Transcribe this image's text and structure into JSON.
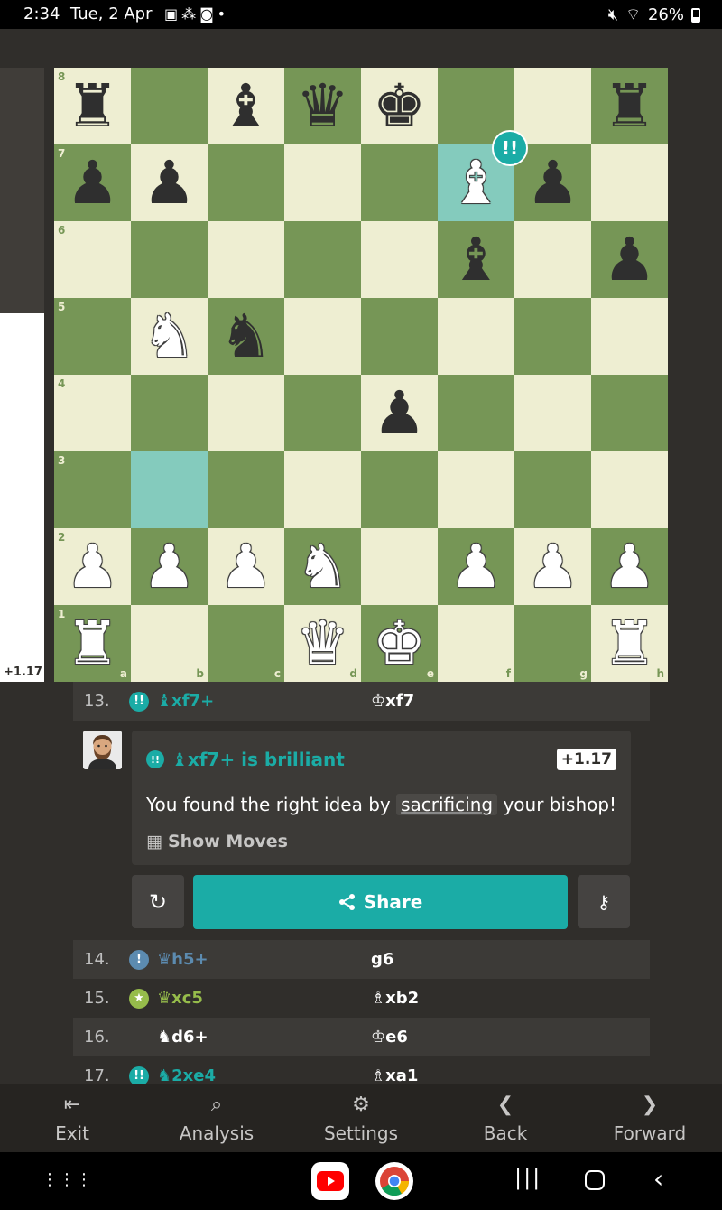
{
  "status": {
    "time": "2:34",
    "date": "Tue, 2 Apr",
    "battery": "26%"
  },
  "eval": {
    "value": "+1.17",
    "white_fraction": 0.6
  },
  "board": {
    "rank_labels": [
      "8",
      "7",
      "6",
      "5",
      "4",
      "3",
      "2",
      "1"
    ],
    "file_labels": [
      "a",
      "b",
      "c",
      "d",
      "e",
      "f",
      "g",
      "h"
    ],
    "rows": [
      [
        "br",
        "",
        "bb",
        "bq",
        "bk",
        "",
        "",
        "br"
      ],
      [
        "bp",
        "bp",
        "",
        "",
        "",
        "wb",
        "bp",
        ""
      ],
      [
        "",
        "",
        "",
        "",
        "",
        "bb",
        "",
        "bp"
      ],
      [
        "",
        "wn",
        "bn",
        "",
        "",
        "",
        "",
        ""
      ],
      [
        "",
        "",
        "",
        "",
        "bp",
        "",
        "",
        ""
      ],
      [
        "",
        "",
        "",
        "",
        "",
        "",
        "",
        ""
      ],
      [
        "wp",
        "wp",
        "wp",
        "wn",
        "",
        "wp",
        "wp",
        "wp"
      ],
      [
        "wr",
        "",
        "",
        "wq",
        "wk",
        "",
        "",
        "wr"
      ]
    ],
    "highlights": [
      "f7",
      "b3"
    ],
    "brilliant_badge": "!!"
  },
  "moves_top": [
    {
      "num": "13.",
      "badge": "!!",
      "white": "♝xf7+",
      "black": "♔xf7"
    }
  ],
  "coach": {
    "badge": "!!",
    "title": "♝xf7+ is brilliant",
    "eval": "+1.17",
    "msg_pre": "You found the right idea by",
    "msg_keyword": "sacrificing",
    "msg_post": "your bishop!",
    "show_moves": "Show Moves"
  },
  "actions": {
    "share": "Share"
  },
  "moves_bottom": [
    {
      "num": "14.",
      "badge": "!",
      "white": "♛h5+",
      "black": "g6"
    },
    {
      "num": "15.",
      "badge": "★",
      "white": "♛xc5",
      "black": "♗xb2"
    },
    {
      "num": "16.",
      "badge": "",
      "white": "♞d6+",
      "black": "♔e6"
    },
    {
      "num": "17.",
      "badge": "!!",
      "white": "♞2xe4",
      "black": "♗xa1"
    }
  ],
  "nav": {
    "exit": "Exit",
    "analysis": "Analysis",
    "settings": "Settings",
    "back": "Back",
    "forward": "Forward"
  },
  "colors": {
    "light_square": "#eeeed2",
    "dark_square": "#769656",
    "highlight": "#84cbbd",
    "brilliant": "#1baca6",
    "background": "#302e2b"
  }
}
